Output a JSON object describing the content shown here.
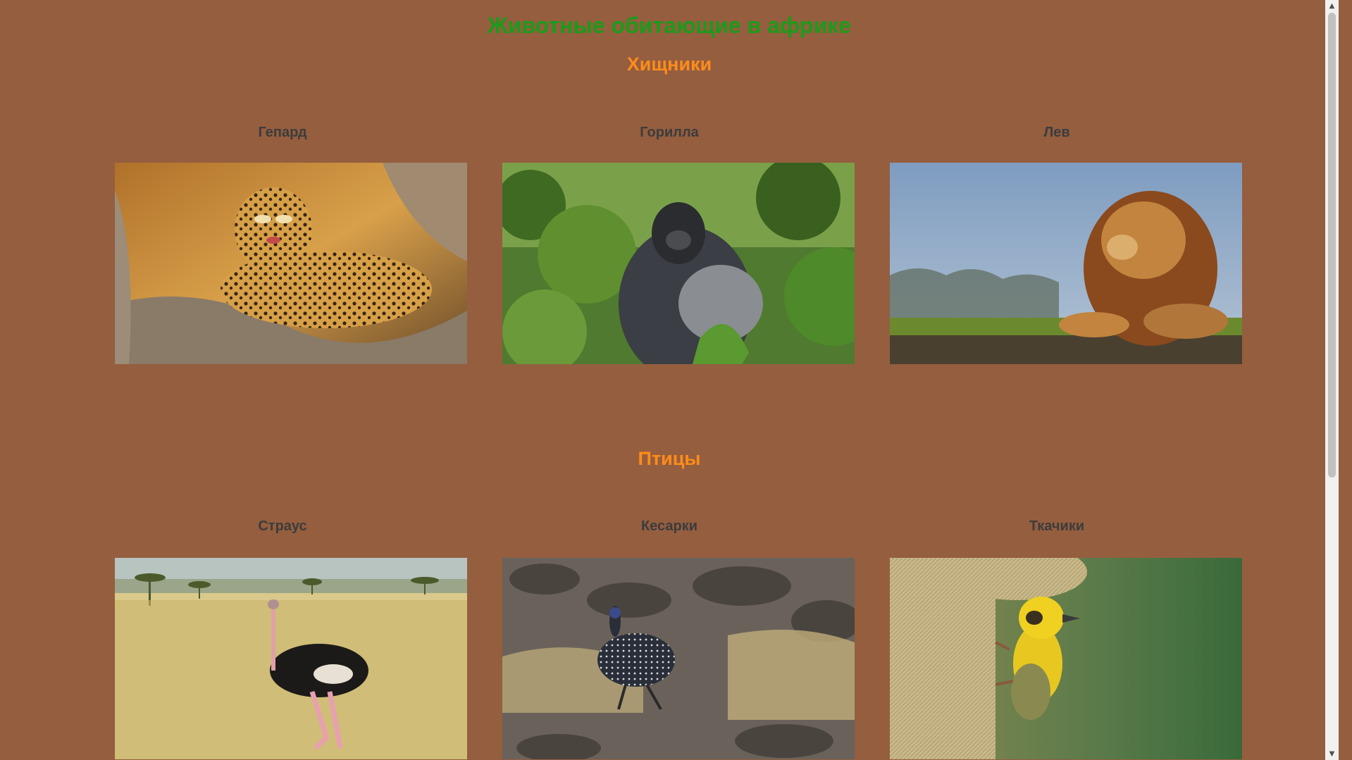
{
  "page": {
    "title": "Животные обитающие в африке"
  },
  "sections": [
    {
      "title": "Хищники",
      "cards": [
        {
          "label": "Гепард"
        },
        {
          "label": "Горилла"
        },
        {
          "label": "Лев"
        }
      ]
    },
    {
      "title": "Птицы",
      "cards": [
        {
          "label": "Страус"
        },
        {
          "label": "Кесарки"
        },
        {
          "label": "Ткачики"
        }
      ]
    }
  ],
  "colors": {
    "background": "#955e3f",
    "title": "#1a9c1a",
    "section_title": "#ff8c1a",
    "card_label": "#3c3c3c"
  },
  "scrollbar": {
    "up_icon": "triangle-up-icon",
    "down_icon": "triangle-down-icon"
  }
}
